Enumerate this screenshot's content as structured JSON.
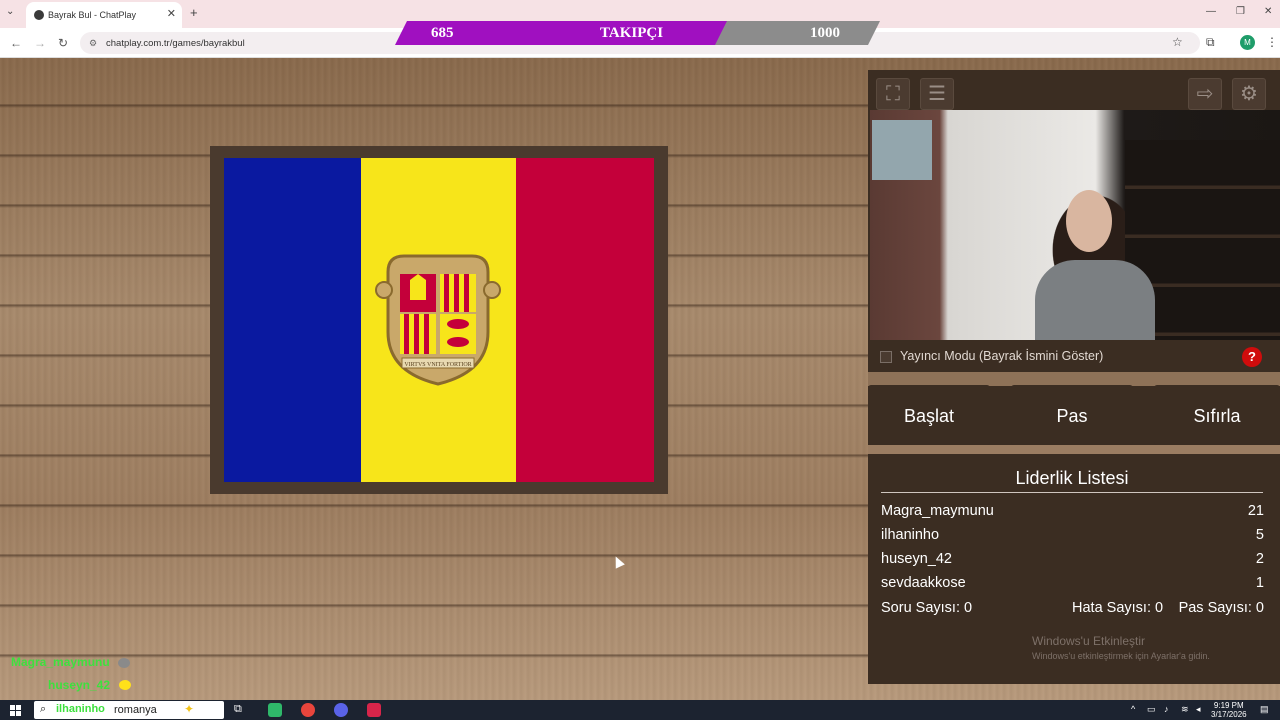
{
  "browser": {
    "tab_title": "Bayrak Bul - ChatPlay",
    "url": "chatplay.com.tr/games/bayrakbul",
    "profile_initial": "M"
  },
  "follower_goal": {
    "current": "685",
    "label": "TAKIPÇI",
    "goal": "1000",
    "progress": 0.685
  },
  "game": {
    "flag_country": "Andorra",
    "coat_motto": "VIRTVS VNITA FORTIOR"
  },
  "panel": {
    "streamer_mode_label": "Yayıncı Modu (Bayrak İsmini Göster)",
    "streamer_mode_checked": false,
    "help_label": "?",
    "buttons": {
      "start": "Başlat",
      "pass": "Pas",
      "reset": "Sıfırla"
    },
    "leaderboard": {
      "title": "Liderlik Listesi",
      "rows": [
        {
          "name": "Magra_maymunu",
          "score": "21"
        },
        {
          "name": "ilhaninho",
          "score": "5"
        },
        {
          "name": "huseyn_42",
          "score": "2"
        },
        {
          "name": "sevdaakkose",
          "score": "1"
        }
      ],
      "stats": {
        "questions": "Soru Sayısı: 0",
        "errors": "Hata Sayısı: 0",
        "passes": "Pas Sayısı: 0"
      }
    },
    "watermark": {
      "line1": "Windows'u Etkinleştir",
      "line2": "Windows'u etkinleştirmek için Ayarlar'a gidin."
    }
  },
  "chat_overlay": [
    {
      "user": "Magra_maymunu",
      "color": "#3ee03e"
    },
    {
      "user": "huseyn_42",
      "color": "#3ee03e"
    },
    {
      "user": "ilhaninho",
      "message": "romanya",
      "color": "#3ee03e"
    }
  ],
  "taskbar": {
    "time": "9:19 PM",
    "date": "3/17/2026"
  },
  "colors": {
    "flag_blue": "#0a19a0",
    "flag_yellow": "#f7e51a",
    "flag_red": "#c4003a",
    "follower_purple": "#a010c0",
    "panel_bg": "#3b2d22",
    "help_red": "#d00c0c"
  }
}
